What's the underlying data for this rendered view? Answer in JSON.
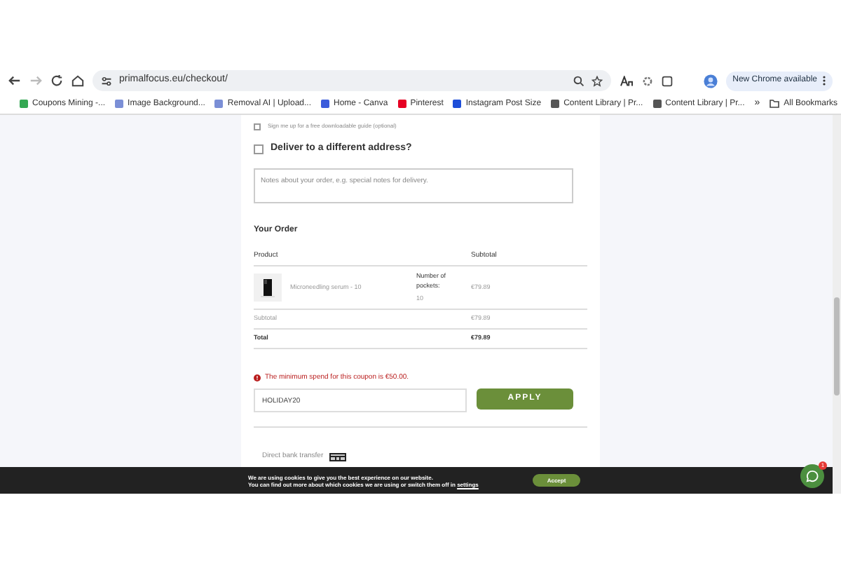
{
  "browser": {
    "url": "primalfocus.eu/checkout/",
    "update_label": "New Chrome available",
    "bookmarks": [
      {
        "label": "Coupons Mining -...",
        "color": "#34a853"
      },
      {
        "label": "Image Background...",
        "color": "#7b8fd6"
      },
      {
        "label": "Removal AI | Upload...",
        "color": "#7b8fd6"
      },
      {
        "label": "Home - Canva",
        "color": "#3b5bdb"
      },
      {
        "label": "Pinterest",
        "color": "#e60023"
      },
      {
        "label": "Instagram Post Size",
        "color": "#1d4ed8"
      },
      {
        "label": "Content Library | Pr...",
        "color": "#555555"
      },
      {
        "label": "Content Library | Pr...",
        "color": "#555555"
      }
    ],
    "more": "»",
    "all_bookmarks": "All Bookmarks"
  },
  "checkout": {
    "signup": {
      "label": "Sign me up for a free downloadable guide (optional)",
      "checked": false
    },
    "deliver": {
      "label": "Deliver to a different address?",
      "checked": false
    },
    "notes": {
      "placeholder": "Notes about your order, e.g. special notes for delivery."
    },
    "order_title": "Your Order",
    "columns": [
      "Product",
      "Subtotal"
    ],
    "item": {
      "name": "Microneedling serum - 10",
      "meta_label": "Number of pockets:",
      "meta_value": "10",
      "price": "€79.89"
    },
    "totals": [
      {
        "label": "Subtotal",
        "value": "€79.89"
      },
      {
        "label": "Total",
        "value": "€79.89"
      }
    ],
    "error": "The minimum spend for this coupon is €50.00.",
    "coupon": {
      "value": "HOLIDAY20",
      "button": "APPLY"
    },
    "payment": "Direct bank transfer"
  },
  "cookie": {
    "line1": "We are using cookies to give you the best experience on our website.",
    "line2": "You can find out more about which cookies we are using or switch them off in ",
    "link": "settings",
    "button": "Accept"
  },
  "chat": {
    "badge": "1"
  }
}
